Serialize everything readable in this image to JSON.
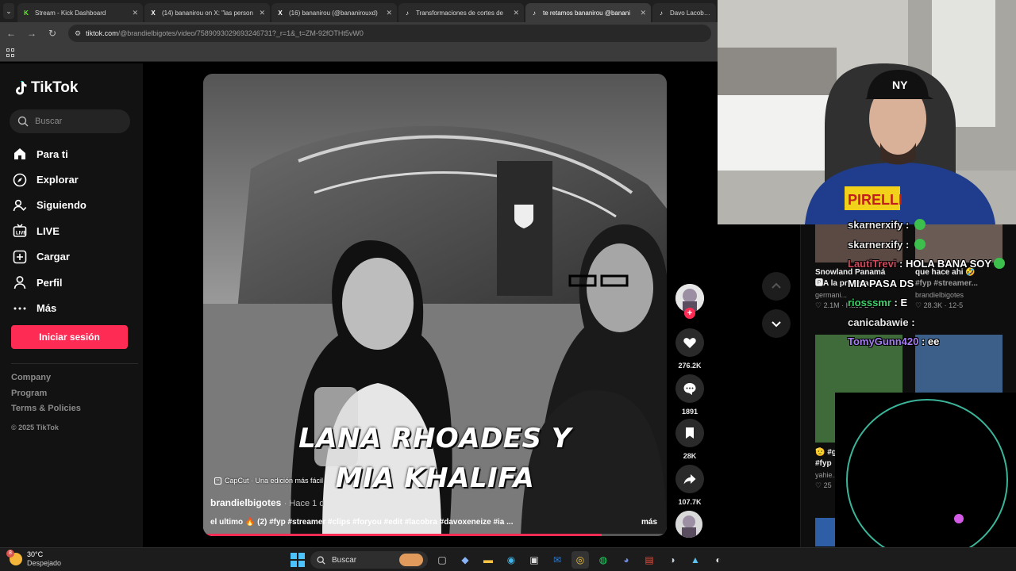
{
  "browser": {
    "tabs": [
      {
        "title": "Stream - Kick Dashboard",
        "favicon": "K",
        "color": "#53fc18",
        "active": false
      },
      {
        "title": "(14) bananirou on X: \"las person",
        "favicon": "X",
        "color": "#ffffff",
        "active": false
      },
      {
        "title": "(16) bananirou (@bananirouxd)",
        "favicon": "X",
        "color": "#ffffff",
        "active": false
      },
      {
        "title": "Transformaciones de cortes de",
        "favicon": "♪",
        "color": "#ffffff",
        "active": false
      },
      {
        "title": "te retamos bananirou @banani",
        "favicon": "♪",
        "color": "#ffffff",
        "active": true
      },
      {
        "title": "Davo Lacobra: Lo",
        "favicon": "♪",
        "color": "#ffffff",
        "active": false
      }
    ],
    "url_site": "tiktok.com",
    "url_path": "/@brandielbigotes/video/7589093029693246731?_r=1&_t=ZM-92fOTHt5vW0"
  },
  "sidebar": {
    "logo": "TikTok",
    "search_placeholder": "Buscar",
    "nav": [
      {
        "label": "Para ti",
        "icon": "home-icon"
      },
      {
        "label": "Explorar",
        "icon": "compass-icon"
      },
      {
        "label": "Siguiendo",
        "icon": "following-icon"
      },
      {
        "label": "LIVE",
        "icon": "live-tv-icon"
      },
      {
        "label": "Cargar",
        "icon": "upload-icon"
      },
      {
        "label": "Perfil",
        "icon": "profile-icon"
      },
      {
        "label": "Más",
        "icon": "more-icon"
      }
    ],
    "login": "Iniciar sesión",
    "footer": [
      "Company",
      "Program",
      "Terms & Policies"
    ],
    "copyright": "© 2025 TikTok"
  },
  "video": {
    "caption_line1": "LANA RHOADES Y",
    "caption_line2": "MIA KHALIFA",
    "capcut": "CapCut · Una edición más fácil",
    "author": "brandielbigotes",
    "ago": "Hace 1 d",
    "description": "el ultimo 🔥 (2) #fyp #streamer #clips #foryou #edit #lacobra #davoxeneize #ia ...",
    "more": "más",
    "progress": 0.86
  },
  "actions": {
    "likes": "276.2K",
    "comments": "1891",
    "saves": "28K",
    "shares": "107.7K"
  },
  "related": [
    {
      "title": "Snowland Panamá",
      "line2": "🅿A la primera...",
      "author": "germani...",
      "likes": "2.1M",
      "ago": "Hace 2 d"
    },
    {
      "title": "que hace ahi 🤣",
      "line2": "#fyp #streamer...",
      "author": "brandielbigotes",
      "likes": "28.3K",
      "ago": "12-5"
    },
    {
      "title": "🫡 #g",
      "line2": "#fyp",
      "author": "yahie...",
      "likes": "25"
    }
  ],
  "chat": [
    {
      "user": "skarnerxify",
      "text": " : ",
      "color": "#e6e6e6",
      "emote": true
    },
    {
      "user": "skarnerxify",
      "text": " : ",
      "color": "#e6e6e6",
      "emote": true
    },
    {
      "user": "LautiTrevi",
      "text": " : HOLA BANA SOY",
      "color": "#d4475b",
      "emote": true
    },
    {
      "user": "",
      "text": "MIA PASA DS",
      "color": "#ffffff",
      "emote": false
    },
    {
      "user": "riosssmr",
      "text": " : E",
      "color": "#3dd16a",
      "emote": false
    },
    {
      "user": "canicabawie",
      "text": " :",
      "color": "#e6e6e6",
      "emote": false
    },
    {
      "user": "TomyGunn420",
      "text": " : ee",
      "color": "#a67ef2",
      "emote": false
    }
  ],
  "taskbar": {
    "temp": "30°C",
    "weather": "Despejado",
    "weather_badge": "8",
    "search": "Buscar"
  },
  "colors": {
    "brand": "#fe2c55",
    "accent_chat_ring": "#3bb59a",
    "ring_dot": "#d35be6"
  }
}
